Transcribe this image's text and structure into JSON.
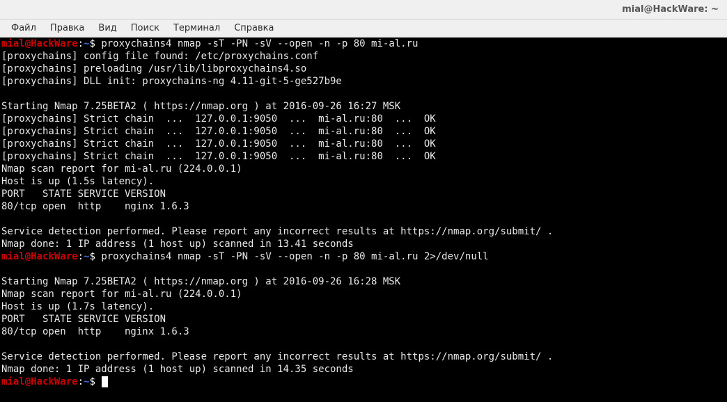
{
  "titlebar": {
    "text": "mial@HackWare: ~"
  },
  "menubar": {
    "items": [
      "Файл",
      "Правка",
      "Вид",
      "Поиск",
      "Терминал",
      "Справка"
    ]
  },
  "prompt": {
    "user": "mial@HackWare",
    "path": "~",
    "sep1": ":",
    "sep2": "$ "
  },
  "session": {
    "cmd1": "proxychains4 nmap -sT -PN -sV --open -n -p 80 mi-al.ru",
    "lines1": [
      "[proxychains] config file found: /etc/proxychains.conf",
      "[proxychains] preloading /usr/lib/libproxychains4.so",
      "[proxychains] DLL init: proxychains-ng 4.11-git-5-ge527b9e",
      "",
      "Starting Nmap 7.25BETA2 ( https://nmap.org ) at 2016-09-26 16:27 MSK",
      "[proxychains] Strict chain  ...  127.0.0.1:9050  ...  mi-al.ru:80  ...  OK",
      "[proxychains] Strict chain  ...  127.0.0.1:9050  ...  mi-al.ru:80  ...  OK",
      "[proxychains] Strict chain  ...  127.0.0.1:9050  ...  mi-al.ru:80  ...  OK",
      "[proxychains] Strict chain  ...  127.0.0.1:9050  ...  mi-al.ru:80  ...  OK",
      "Nmap scan report for mi-al.ru (224.0.0.1)",
      "Host is up (1.5s latency).",
      "PORT   STATE SERVICE VERSION",
      "80/tcp open  http    nginx 1.6.3",
      "",
      "Service detection performed. Please report any incorrect results at https://nmap.org/submit/ .",
      "Nmap done: 1 IP address (1 host up) scanned in 13.41 seconds"
    ],
    "cmd2": "proxychains4 nmap -sT -PN -sV --open -n -p 80 mi-al.ru 2>/dev/null",
    "lines2": [
      "",
      "Starting Nmap 7.25BETA2 ( https://nmap.org ) at 2016-09-26 16:28 MSK",
      "Nmap scan report for mi-al.ru (224.0.0.1)",
      "Host is up (1.7s latency).",
      "PORT   STATE SERVICE VERSION",
      "80/tcp open  http    nginx 1.6.3",
      "",
      "Service detection performed. Please report any incorrect results at https://nmap.org/submit/ .",
      "Nmap done: 1 IP address (1 host up) scanned in 14.35 seconds"
    ]
  }
}
